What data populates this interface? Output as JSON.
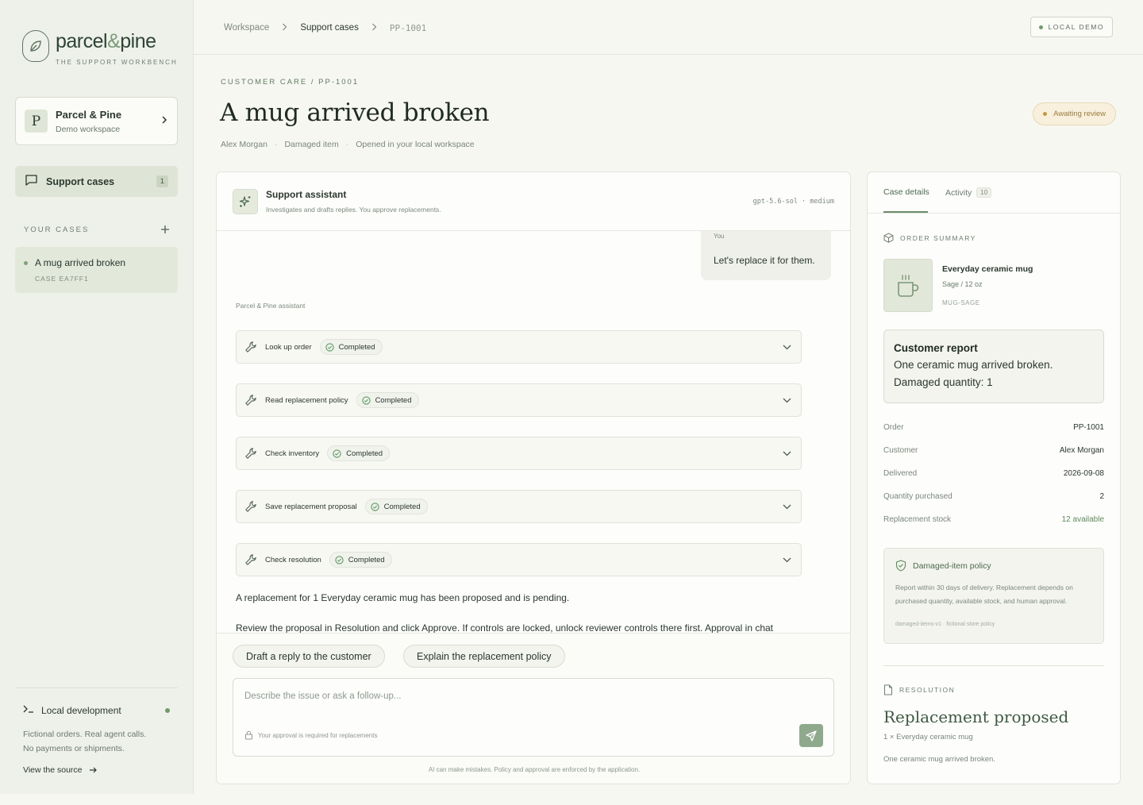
{
  "brand": {
    "name_part1": "parcel",
    "name_amp": "&",
    "name_part2": "pine",
    "tagline": "THE SUPPORT WORKBENCH"
  },
  "workspace": {
    "avatar_letter": "P",
    "name": "Parcel & Pine",
    "subtitle": "Demo workspace"
  },
  "nav": {
    "support_cases_label": "Support cases",
    "support_cases_count": "1"
  },
  "your_cases": {
    "label": "YOUR CASES",
    "items": [
      {
        "title": "A mug arrived broken",
        "id": "CASE EA7FF1"
      }
    ]
  },
  "local_dev": {
    "title": "Local development",
    "desc_line1": "Fictional orders. Real agent calls.",
    "desc_line2": "No payments or shipments.",
    "link": "View the source"
  },
  "breadcrumb": {
    "items": [
      "Workspace",
      "Support cases",
      "PP-1001"
    ]
  },
  "local_demo_badge": "LOCAL DEMO",
  "case": {
    "eyebrow": "CUSTOMER CARE / PP-1001",
    "title": "A mug arrived broken",
    "meta": [
      "Alex Morgan",
      "Damaged item",
      "Opened in your local workspace"
    ],
    "status": "Awaiting review"
  },
  "chat": {
    "assistant_name": "Support assistant",
    "assistant_sub": "Investigates and drafts replies. You approve replacements.",
    "model": "gpt-5.6-sol · medium",
    "user_label": "You",
    "user_message": "Let's replace it for them.",
    "assistant_label": "Parcel & Pine assistant",
    "tools": [
      {
        "name": "Look up order",
        "status": "Completed"
      },
      {
        "name": "Read replacement policy",
        "status": "Completed"
      },
      {
        "name": "Check inventory",
        "status": "Completed"
      },
      {
        "name": "Save replacement proposal",
        "status": "Completed"
      },
      {
        "name": "Check resolution",
        "status": "Completed"
      }
    ],
    "reply_1": "A replacement for 1 Everyday ceramic mug has been proposed and is pending.",
    "reply_2": "Review the proposal in Resolution and click Approve. If controls are locked, unlock reviewer controls there first. Approval in chat",
    "suggestions": [
      "Draft a reply to the customer",
      "Explain the replacement policy"
    ],
    "input_placeholder": "Describe the issue or ask a follow-up...",
    "approval_note": "Your approval is required for replacements",
    "disclaimer": "AI can make mistakes. Policy and approval are enforced by the application."
  },
  "details": {
    "tabs": [
      {
        "label": "Case details"
      },
      {
        "label": "Activity",
        "count": "10"
      }
    ],
    "order_summary_label": "ORDER SUMMARY",
    "product": {
      "name": "Everyday ceramic mug",
      "variant": "Sage / 12 oz",
      "sku": "MUG-SAGE"
    },
    "report": {
      "heading": "Customer report",
      "line1": "One ceramic mug arrived broken.",
      "line2": "Damaged quantity: 1"
    },
    "fields": [
      {
        "key": "Order",
        "value": "PP-1001"
      },
      {
        "key": "Customer",
        "value": "Alex Morgan"
      },
      {
        "key": "Delivered",
        "value": "2026-09-08"
      },
      {
        "key": "Quantity purchased",
        "value": "2"
      },
      {
        "key": "Replacement stock",
        "value": "12 available"
      }
    ],
    "policy": {
      "title": "Damaged-item policy",
      "desc": "Report within 30 days of delivery. Replacement depends on purchased quantity, available stock, and human approval.",
      "meta": "damaged-items-v1 · fictional store policy"
    },
    "resolution": {
      "label": "RESOLUTION",
      "title": "Replacement proposed",
      "item": "1 × Everyday ceramic mug",
      "note": "One ceramic mug arrived broken."
    }
  },
  "colors": {
    "accent": "#6b8b68",
    "status_pending": "#c49a3e",
    "send_button": "#8fa98c"
  }
}
